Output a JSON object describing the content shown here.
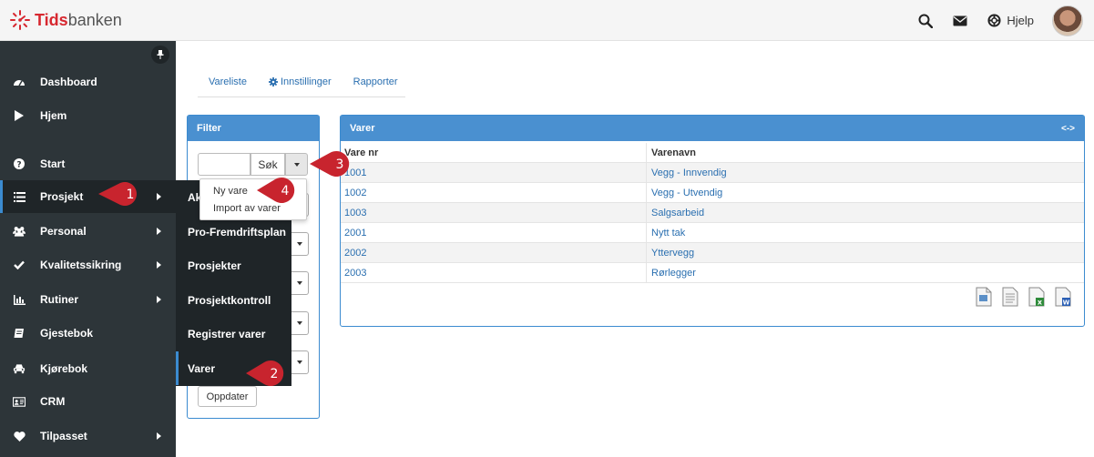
{
  "topbar": {
    "logo_bold": "Tids",
    "logo_rest": "banken",
    "help_label": "Hjelp",
    "icons": [
      "search-icon",
      "envelope-icon",
      "lifebuoy-icon"
    ]
  },
  "sidebar": {
    "items": [
      {
        "label": "Dashboard",
        "icon": "dashboard-icon"
      },
      {
        "label": "Hjem",
        "icon": "play-icon"
      },
      {
        "label": "Start",
        "icon": "question-circle-icon"
      },
      {
        "label": "Prosjekt",
        "icon": "list-icon"
      },
      {
        "label": "Personal",
        "icon": "users-icon"
      },
      {
        "label": "Kvalitetssikring",
        "icon": "check-icon"
      },
      {
        "label": "Rutiner",
        "icon": "bar-chart-icon"
      },
      {
        "label": "Gjestebok",
        "icon": "book-icon"
      },
      {
        "label": "Kjørebok",
        "icon": "car-icon"
      },
      {
        "label": "CRM",
        "icon": "id-card-icon"
      },
      {
        "label": "Tilpasset",
        "icon": "heart-icon"
      }
    ]
  },
  "submenu": {
    "items": [
      {
        "label": "Ak"
      },
      {
        "label": "Pro-Fremdriftsplan"
      },
      {
        "label": "Prosjekter"
      },
      {
        "label": "Prosjektkontroll"
      },
      {
        "label": "Registrer varer"
      },
      {
        "label": "Varer"
      }
    ]
  },
  "tabs": [
    {
      "label": "Vareliste"
    },
    {
      "label": "Innstillinger"
    },
    {
      "label": "Rapporter"
    }
  ],
  "filter": {
    "title": "Filter",
    "search_button": "Søk",
    "search_value": "",
    "update_button": "Oppdater",
    "dropdown": [
      "Ny vare",
      "Import av varer"
    ]
  },
  "varer": {
    "title": "Varer",
    "expand_label": "<->",
    "columns": [
      "Vare nr",
      "Varenavn"
    ],
    "rows": [
      {
        "nr": "1001",
        "name": "Vegg - Innvendig"
      },
      {
        "nr": "1002",
        "name": "Vegg - Utvendig"
      },
      {
        "nr": "1003",
        "name": "Salgsarbeid"
      },
      {
        "nr": "2001",
        "name": "Nytt tak"
      },
      {
        "nr": "2002",
        "name": "Yttervegg"
      },
      {
        "nr": "2003",
        "name": "Rørlegger"
      }
    ],
    "export_icons": [
      "export-file-icon",
      "text-file-icon",
      "excel-file-icon",
      "word-file-icon"
    ]
  },
  "callouts": [
    "1",
    "2",
    "3",
    "4"
  ],
  "colors": {
    "sidebar": "#2d3539",
    "sidebar_active": "#1f2528",
    "panel_header": "#4a90d0",
    "link": "#2a6fb0",
    "callout": "#c8242e",
    "brand_red": "#d72830"
  }
}
